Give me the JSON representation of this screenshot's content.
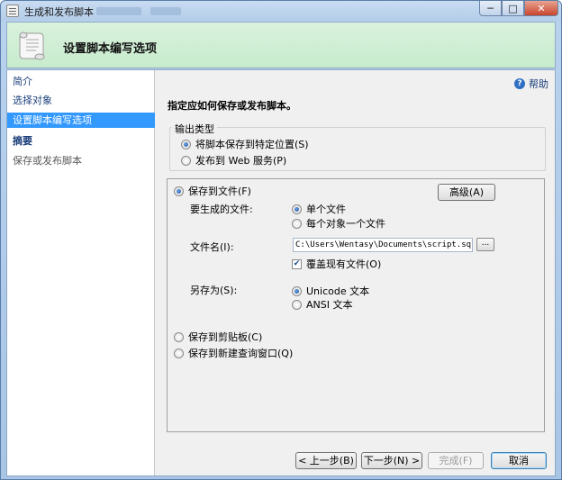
{
  "window": {
    "title": "生成和发布脚本",
    "controls": {
      "minimize": "─",
      "maximize": "□",
      "close": "✕"
    }
  },
  "header": {
    "title": "设置脚本编写选项",
    "icon": "scroll-icon"
  },
  "nav": {
    "items": [
      {
        "label": "简介",
        "state": "normal"
      },
      {
        "label": "选择对象",
        "state": "normal"
      },
      {
        "label": "设置脚本编写选项",
        "state": "selected"
      },
      {
        "label": "摘要",
        "state": "bold"
      },
      {
        "label": "保存或发布脚本",
        "state": "disabled"
      }
    ]
  },
  "help": {
    "label": "帮助",
    "icon_glyph": "?"
  },
  "main": {
    "instruction": "指定应如何保存或发布脚本。",
    "output_type": {
      "label": "输出类型",
      "options": [
        {
          "label": "将脚本保存到特定位置(S)",
          "selected": true
        },
        {
          "label": "发布到 Web 服务(P)",
          "selected": false
        }
      ]
    },
    "destination": {
      "save_to_file": {
        "label": "保存到文件(F)",
        "selected": true
      },
      "advanced_button": "高级(A)",
      "files_to_generate": {
        "label": "要生成的文件:",
        "options": [
          {
            "label": "单个文件",
            "selected": true
          },
          {
            "label": "每个对象一个文件",
            "selected": false
          }
        ]
      },
      "file_name": {
        "label": "文件名(I):",
        "value": "C:\\Users\\Wentasy\\Documents\\script.sql",
        "browse_label": "..."
      },
      "overwrite": {
        "label": "覆盖现有文件(O)",
        "checked": true
      },
      "save_as": {
        "label": "另存为(S):",
        "options": [
          {
            "label": "Unicode 文本",
            "selected": true
          },
          {
            "label": "ANSI 文本",
            "selected": false
          }
        ]
      },
      "save_to_clipboard": {
        "label": "保存到剪贴板(C)",
        "selected": false
      },
      "save_to_query_window": {
        "label": "保存到新建查询窗口(Q)",
        "selected": false
      }
    }
  },
  "footer": {
    "prev": "< 上一步(B)",
    "next": "下一步(N) >",
    "finish": "完成(F)",
    "cancel": "取消"
  },
  "colors": {
    "header_bg": "#d4f0d8",
    "selection": "#3399ff",
    "frame": "#b4cde9"
  }
}
